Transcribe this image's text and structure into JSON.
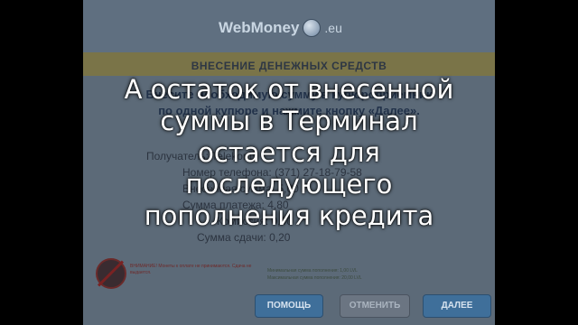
{
  "terminal": {
    "logo_text": "WebMoney",
    "logo_tld": ".eu",
    "section_title": "ВНЕСЕНИЕ ДЕНЕЖНЫХ СРЕДСТВ",
    "instruction_line1": "Внесите необходимую сумму в купюроприемник",
    "instruction_line2": "по одной купюре и нажмите кнопку «Далее».",
    "details": [
      {
        "label": "Получатель:",
        "value": "Telekom"
      },
      {
        "label": "Номер телефона:",
        "value": "(371) 27-18-79-58"
      },
      {
        "label": "Внесённая сумма:",
        "value": "5,00"
      },
      {
        "label": "Сумма платежа:",
        "value": "4,80"
      },
      {
        "label": "Комиссия:",
        "value": "0,00"
      },
      {
        "label": "Сумма сдачи:",
        "value": "0,20"
      }
    ],
    "warning_text": "ВНИМАНИЕ! Монеты к оплате не принимаются. Сдача не выдается.",
    "limit_min": "Минимальная сумма пополнения: 1,00 LVL",
    "limit_max": "Максимальная сумма пополнения: 20,00 LVL",
    "buttons": {
      "help": "ПОМОЩЬ",
      "cancel": "ОТМЕНИТЬ",
      "next": "ДАЛЕЕ"
    }
  },
  "overlay_caption": [
    "А остаток от внесенной",
    "суммы в  Терминал",
    "остается для",
    "последующего",
    "пополнения кредита"
  ],
  "colors": {
    "background": "#000000",
    "terminal_panel": "#5c6a78",
    "button_blue": "#3f6f9a",
    "caption_text": "#ffffff"
  }
}
